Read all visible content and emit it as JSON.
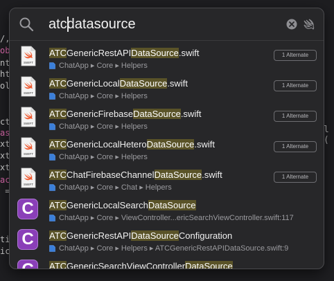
{
  "background": {
    "left_fragments": [
      {
        "text": "/,",
        "color": "#d0d0d0"
      },
      {
        "text": "obl",
        "color": "#e06cb0"
      },
      {
        "text": "nt",
        "color": "#d0d0d0"
      },
      {
        "text": "ht",
        "color": "#d0d0d0"
      },
      {
        "text": "ol",
        "color": "#d0d0d0"
      },
      {
        "text": "ct",
        "color": "#d0d0d0"
      },
      {
        "text": "as",
        "color": "#e06cb0"
      },
      {
        "text": "xt",
        "color": "#d0d0d0"
      },
      {
        "text": "xt",
        "color": "#d0d0d0"
      },
      {
        "text": "xt",
        "color": "#d0d0d0"
      },
      {
        "text": "ac",
        "color": "#e06cb0"
      },
      {
        "text": " =",
        "color": "#d0d0d0"
      },
      {
        "text": "ti",
        "color": "#d0d0d0"
      },
      {
        "text": "ic",
        "color": "#d0d0d0"
      }
    ],
    "right_fragment": "l ("
  },
  "search": {
    "query": "atcdatasource",
    "icons": {
      "search": "magnifier-icon",
      "clear": "clear-circle-icon",
      "scope": "swift-bird-icon"
    }
  },
  "results": [
    {
      "icon": "swift-file",
      "title_parts": [
        {
          "t": "ATC",
          "hl": true
        },
        {
          "t": "GenericRestAPI",
          "hl": false
        },
        {
          "t": "DataSource",
          "hl": true
        },
        {
          "t": ".swift",
          "hl": false
        }
      ],
      "path": "ChatApp ▸ Core ▸ Helpers",
      "badge": "1 Alternate"
    },
    {
      "icon": "swift-file",
      "title_parts": [
        {
          "t": "ATC",
          "hl": true
        },
        {
          "t": "GenericLocal",
          "hl": false
        },
        {
          "t": "DataSource",
          "hl": true
        },
        {
          "t": ".swift",
          "hl": false
        }
      ],
      "path": "ChatApp ▸ Core ▸ Helpers",
      "badge": "1 Alternate"
    },
    {
      "icon": "swift-file",
      "title_parts": [
        {
          "t": "ATC",
          "hl": true
        },
        {
          "t": "GenericFirebase",
          "hl": false
        },
        {
          "t": "DataSource",
          "hl": true
        },
        {
          "t": ".swift",
          "hl": false
        }
      ],
      "path": "ChatApp ▸ Core ▸ Helpers",
      "badge": "1 Alternate"
    },
    {
      "icon": "swift-file",
      "title_parts": [
        {
          "t": "ATC",
          "hl": true
        },
        {
          "t": "GenericLocalHetero",
          "hl": false
        },
        {
          "t": "DataSource",
          "hl": true
        },
        {
          "t": ".swift",
          "hl": false
        }
      ],
      "path": "ChatApp ▸ Core ▸ Helpers",
      "badge": "1 Alternate"
    },
    {
      "icon": "swift-file",
      "title_parts": [
        {
          "t": "ATC",
          "hl": true
        },
        {
          "t": "ChatFirebaseChannel",
          "hl": false
        },
        {
          "t": "DataSource",
          "hl": true
        },
        {
          "t": ".swift",
          "hl": false
        }
      ],
      "path": "ChatApp ▸ Core ▸ Chat ▸ Helpers",
      "badge": "1 Alternate"
    },
    {
      "icon": "class-symbol",
      "icon_letter": "C",
      "title_parts": [
        {
          "t": "ATC",
          "hl": true
        },
        {
          "t": "GenericLocalSearch",
          "hl": false
        },
        {
          "t": "DataSource",
          "hl": true
        }
      ],
      "path": "ChatApp ▸ Core ▸ ViewController...ericSearchViewController.swift:117",
      "badge": ""
    },
    {
      "icon": "class-symbol",
      "icon_letter": "C",
      "title_parts": [
        {
          "t": "ATC",
          "hl": true
        },
        {
          "t": "GenericRestAPI",
          "hl": false
        },
        {
          "t": "DataSource",
          "hl": true
        },
        {
          "t": "Configuration",
          "hl": false
        }
      ],
      "path": "ChatApp ▸ Core ▸ Helpers ▸ ATCGenericRestAPIDataSource.swift:9",
      "badge": ""
    },
    {
      "icon": "class-symbol",
      "icon_letter": "C",
      "title_parts": [
        {
          "t": "ATC",
          "hl": true
        },
        {
          "t": "GenericSearchViewController",
          "hl": false
        },
        {
          "t": "DataSource",
          "hl": true
        }
      ],
      "path": "",
      "badge": ""
    }
  ],
  "colors": {
    "highlight": "#5a5328",
    "class_icon": "#8a3fb8",
    "swift_orange": "#f0582e"
  }
}
